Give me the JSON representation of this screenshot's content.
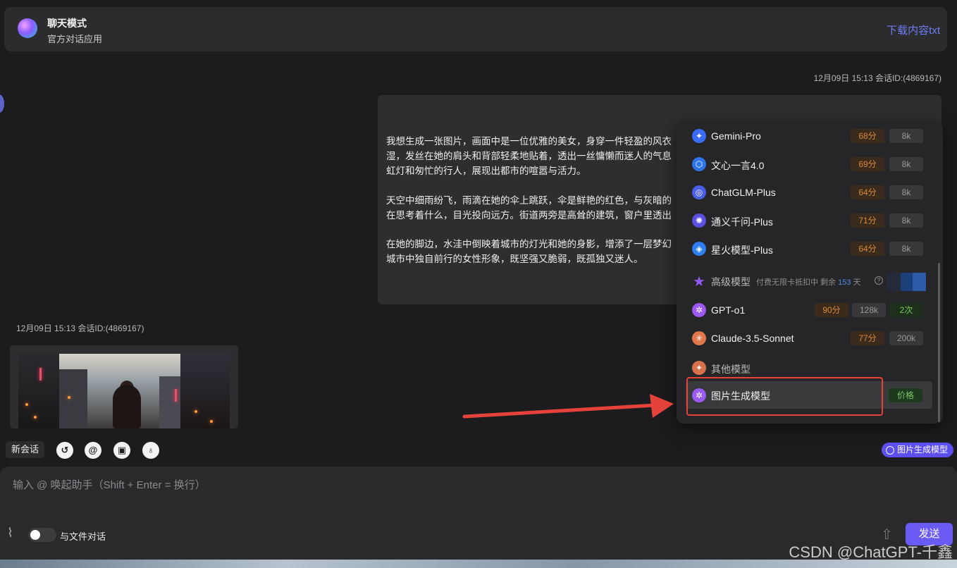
{
  "header": {
    "title": "聊天模式",
    "subtitle": "官方对话应用",
    "download_label": "下载内容txt"
  },
  "messages": {
    "user_timestamp": "12月09日 15:13 会话ID:(4869167)",
    "user_paragraphs": [
      "我想生成一张图片，画面中是一位优雅的美女，身穿一件轻盈的风衣",
      "湿，发丝在她的肩头和背部轻柔地贴着，透出一丝慵懒而迷人的气息",
      "虹灯和匆忙的行人，展现出都市的喧嚣与活力。",
      "天空中细雨纷飞，雨滴在她的伞上跳跃，伞是鲜艳的红色，与灰暗的",
      "在思考着什么，目光投向远方。街道两旁是高耸的建筑，窗户里透出",
      "在她的脚边，水洼中倒映着城市的灯光和她的身影，增添了一层梦幻",
      "城市中独自前行的女性形象，既坚强又脆弱，既孤独又迷人。"
    ],
    "assistant_timestamp": "12月09日 15:13 会话ID:(4869167)"
  },
  "model_menu": {
    "models": [
      {
        "name": "Gemini-Pro",
        "score": "68分",
        "context": "8k",
        "icon": "gemini-icon",
        "color": "#3b6cf5"
      },
      {
        "name": "文心一言4.0",
        "score": "69分",
        "context": "8k",
        "icon": "wenxin-icon",
        "color": "#2f74e8"
      },
      {
        "name": "ChatGLM-Plus",
        "score": "64分",
        "context": "8k",
        "icon": "chatglm-icon",
        "color": "#4d5ee6"
      },
      {
        "name": "通义千问-Plus",
        "score": "71分",
        "context": "8k",
        "icon": "tongyi-icon",
        "color": "#5a4fe0"
      },
      {
        "name": "星火模型-Plus",
        "score": "64分",
        "context": "8k",
        "icon": "xinghuo-icon",
        "color": "#2d7ff0"
      }
    ],
    "premium_group": {
      "title": "高级模型",
      "note_prefix": "付费无限卡抵扣中 剩余",
      "days": "153",
      "note_suffix": "天",
      "help": "?"
    },
    "premium_models": [
      {
        "name": "GPT-o1",
        "score": "90分",
        "context": "128k",
        "count": "2次",
        "icon": "openai-icon",
        "color": "#9a5bf0"
      },
      {
        "name": "Claude-3.5-Sonnet",
        "score": "77分",
        "context": "200k",
        "icon": "claude-icon",
        "color": "#e0774b"
      }
    ],
    "other_group": {
      "title": "其他模型"
    },
    "image_model": {
      "name": "图片生成模型",
      "price": "价格",
      "icon": "openai-icon"
    }
  },
  "toolbar": {
    "new_session": "新会话",
    "model_chip": "图片生成模型"
  },
  "input": {
    "placeholder": "输入 @ 唤起助手（Shift + Enter = 换行）",
    "value": "",
    "file_toggle_label": "与文件对话",
    "send_label": "发送"
  },
  "watermark": "CSDN @ChatGPT-千鑫",
  "colors": {
    "accent": "#6b5bf5",
    "highlight_box": "#e5423b",
    "link": "#6f7cf2"
  }
}
